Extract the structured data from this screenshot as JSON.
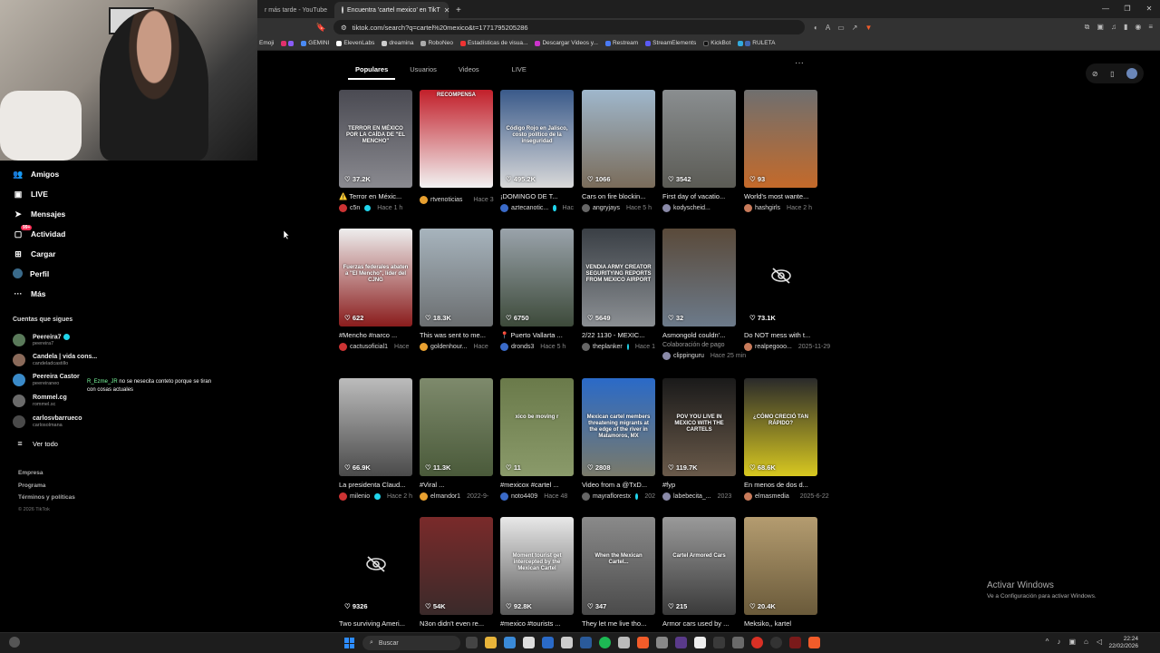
{
  "browser": {
    "tabs": [
      {
        "title": "r más tarde - YouTube",
        "active": false
      },
      {
        "title": "Encuentra 'cartel mexico' en TikT",
        "active": true
      }
    ],
    "url": "tiktok.com/search?q=cartel%20mexico&t=1771795205286",
    "bookmarks": [
      "Emoji",
      "GEMINI",
      "ElevenLabs",
      "dreamina",
      "RoboNeo",
      "Estadísticas de visua...",
      "Descargar Videos y...",
      "Restream",
      "StreamElements",
      "KickBot",
      "RULETA"
    ]
  },
  "sidebar": {
    "nav": [
      {
        "label": "Amigos",
        "icon": "friends-icon"
      },
      {
        "label": "LIVE",
        "icon": "live-icon"
      },
      {
        "label": "Mensajes",
        "icon": "messages-icon"
      },
      {
        "label": "Actividad",
        "icon": "activity-icon",
        "badge": "99+"
      },
      {
        "label": "Cargar",
        "icon": "upload-icon"
      },
      {
        "label": "Perfil",
        "icon": "profile-icon"
      },
      {
        "label": "Más",
        "icon": "more-icon"
      }
    ],
    "following_title": "Cuentas que sigues",
    "following": [
      {
        "name": "Peereira7",
        "handle": "peereira7",
        "verified": true
      },
      {
        "name": "Candela | vida cons...",
        "handle": "candeladcastillo",
        "verified": false
      },
      {
        "name": "Peereira Castor",
        "handle": "peereiraneo",
        "verified": false
      },
      {
        "name": "Rommel.cg",
        "handle": "rommel.sc",
        "verified": false
      },
      {
        "name": "carlosvbarrueco",
        "handle": "carlosolmana",
        "verified": false
      }
    ],
    "see_all": "Ver todo",
    "chat_user": "R_Ezme_JR",
    "chat_msg": "no se nesecita conteto porque se tiran con cosas actuales",
    "footer": [
      "Empresa",
      "Programa",
      "Términos y políticas"
    ],
    "copyright": "© 2026 TikTok"
  },
  "search_tabs": [
    "Populares",
    "Usuarios",
    "Videos",
    "LIVE"
  ],
  "videos": [
    {
      "likes": "37.2K",
      "caption": "⚠️ Terror en Méxic...",
      "user": "c5n",
      "verified": true,
      "time": "Hace 1 h",
      "thumb_text": "TERROR EN MÉXICO POR LA CAÍDA DE \"EL MENCHO\"",
      "colors": [
        "#4a4a52",
        "#8a8a90"
      ]
    },
    {
      "likes": "",
      "caption": "",
      "user": "rtvenoticias",
      "verified": true,
      "time": "Hace 3",
      "thumb_text": "RECOMPENSA",
      "colors": [
        "#c21f2a",
        "#f2f2f2"
      ]
    },
    {
      "likes": "495.2K",
      "caption": "¡DOMINGO DE T...",
      "user": "aztecanotic...",
      "verified": true,
      "time": "Hac",
      "thumb_text": "Código Rojo en Jalisco, costo político de la inseguridad",
      "colors": [
        "#3a5a8a",
        "#d9d9d9"
      ]
    },
    {
      "likes": "1066",
      "caption": "Cars on fire blockin...",
      "user": "angryjays",
      "verified": false,
      "time": "Hace 5 h",
      "thumb_text": "",
      "colors": [
        "#9fb7cc",
        "#7a6c5a"
      ]
    },
    {
      "likes": "3542",
      "caption": "First day of vacatio...",
      "user": "kodyscheid...",
      "verified": false,
      "time": "",
      "thumb_text": "",
      "colors": [
        "#8a8e90",
        "#5b5b55"
      ]
    },
    {
      "likes": "93",
      "caption": "World's most wante...",
      "user": "hashgirls",
      "verified": false,
      "time": "Hace 2 h",
      "thumb_text": "",
      "colors": [
        "#6f6f6f",
        "#c46a2a"
      ]
    },
    {
      "likes": "622",
      "caption": "#Mencho #narco ...",
      "user": "cactusoficial1",
      "verified": false,
      "time": "Hace",
      "thumb_text": "Fuerzas federales abaten a \"El Mencho\", líder del CJNG",
      "colors": [
        "#eeeeee",
        "#8a1c1c"
      ]
    },
    {
      "likes": "18.3K",
      "caption": "This was sent to me...",
      "user": "goldenhour...",
      "verified": false,
      "time": "Hace",
      "thumb_text": "",
      "colors": [
        "#a7b4bd",
        "#6b6e70"
      ]
    },
    {
      "likes": "6750",
      "caption": "📍 Puerto Vallarta ...",
      "user": "dronds3",
      "verified": false,
      "time": "Hace 5 h",
      "thumb_text": "",
      "colors": [
        "#9aa3ab",
        "#3d4a3a"
      ]
    },
    {
      "likes": "5649",
      "caption": "2/22 1130 - MEXIC...",
      "user": "theplanker",
      "verified": true,
      "time": "Hace 1",
      "thumb_text": "VENDIA ARMY CREATOR SEGURITYING REPORTS FROM MEXICO AIRPORT",
      "colors": [
        "#3a3f45",
        "#8b8f93"
      ]
    },
    {
      "likes": "32",
      "caption": "Asmongold couldn'...",
      "user": "clippinguru",
      "verified": false,
      "time": "Hace 25 min",
      "extra": "Colaboración de pago",
      "thumb_text": "",
      "colors": [
        "#5a4a3a",
        "#6c7a8a"
      ]
    },
    {
      "likes": "73.1K",
      "caption": "Do NOT mess with t...",
      "user": "realpegooo...",
      "verified": false,
      "time": "2025-11-29",
      "thumb_text": "",
      "hidden": true,
      "colors": [
        "#000000",
        "#000000"
      ]
    },
    {
      "likes": "66.9K",
      "caption": "La presidenta Claud...",
      "user": "milenio",
      "verified": true,
      "time": "Hace 2 h",
      "thumb_text": "",
      "colors": [
        "#bcbcbc",
        "#4a4a4a"
      ]
    },
    {
      "likes": "11.3K",
      "caption": "#Viral ...",
      "user": "elmandor1",
      "verified": false,
      "time": "2022-9-",
      "thumb_text": "",
      "colors": [
        "#7e8a6c",
        "#4a5a3a"
      ]
    },
    {
      "likes": "11",
      "caption": "#mexicox #cartel ...",
      "user": "noto4409",
      "verified": false,
      "time": "Hace 48",
      "thumb_text": "xico be moving r",
      "colors": [
        "#6a7a4a",
        "#8a9a6a"
      ]
    },
    {
      "likes": "2808",
      "caption": "Video from a @TxD...",
      "user": "mayraflorestx",
      "verified": true,
      "time": "202",
      "thumb_text": "Mexican cartel members threatening migrants at the edge of the river in Matamoros, MX",
      "colors": [
        "#2a6ac8",
        "#7a7a6a"
      ]
    },
    {
      "likes": "119.7K",
      "caption": "#fyp",
      "user": "labebecita_...",
      "verified": false,
      "time": "2023",
      "thumb_text": "POV YOU LIVE IN MEXICO WITH THE CARTELS",
      "colors": [
        "#1a1a1a",
        "#6a5a4a"
      ]
    },
    {
      "likes": "68.6K",
      "caption": "En menos de dos d...",
      "user": "elmasmedia",
      "verified": true,
      "time": "2025-6-22",
      "thumb_text": "¿CÓMO CRECIÓ TAN RÁPIDO?",
      "colors": [
        "#2a2a2a",
        "#d8c820"
      ]
    },
    {
      "likes": "9326",
      "caption": "Two surviving Ameri...",
      "user": "",
      "verified": false,
      "time": "",
      "thumb_text": "",
      "hidden": true,
      "colors": [
        "#000000",
        "#000000"
      ]
    },
    {
      "likes": "54K",
      "caption": "N3on didn't even re...",
      "user": "",
      "verified": false,
      "time": "",
      "thumb_text": "",
      "colors": [
        "#7a2a2a",
        "#3a2a2a"
      ]
    },
    {
      "likes": "92.8K",
      "caption": "#mexico #tourists ...",
      "user": "",
      "verified": false,
      "time": "",
      "thumb_text": "Moment tourist get intercepted by the Mexican Cartel",
      "colors": [
        "#e8e8e8",
        "#5a5a5a"
      ]
    },
    {
      "likes": "347",
      "caption": "They let me live tho...",
      "user": "",
      "verified": false,
      "time": "",
      "thumb_text": "When the Mexican Cartel...",
      "colors": [
        "#8a8a8a",
        "#4a4a4a"
      ]
    },
    {
      "likes": "215",
      "caption": "Armor cars used by ...",
      "user": "",
      "verified": false,
      "time": "",
      "thumb_text": "Cartel Armored Cars",
      "colors": [
        "#9a9a9a",
        "#3a3a3a"
      ]
    },
    {
      "likes": "20.4K",
      "caption": "Meksiko,, kartel",
      "user": "",
      "verified": false,
      "time": "",
      "thumb_text": "",
      "colors": [
        "#b49c70",
        "#6a5a3a"
      ]
    }
  ],
  "activation": {
    "title": "Activar Windows",
    "subtitle": "Ve a Configuración para activar Windows."
  },
  "taskbar": {
    "search": "Buscar",
    "time": "22:24",
    "date": "22/02/2026"
  }
}
